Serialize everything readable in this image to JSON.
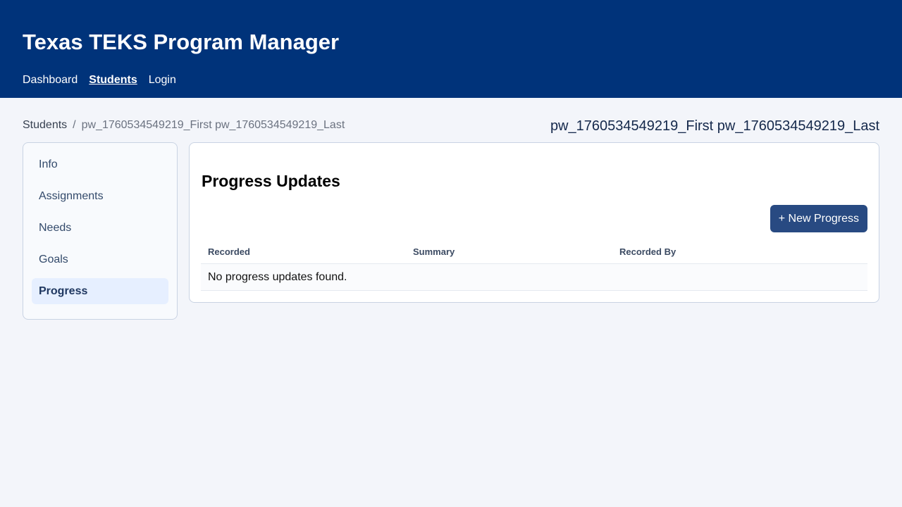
{
  "header": {
    "title": "Texas TEKS Program Manager",
    "nav": [
      {
        "label": "Dashboard"
      },
      {
        "label": "Students",
        "active": true
      },
      {
        "label": "Login"
      }
    ]
  },
  "breadcrumb": {
    "root": "Students",
    "separator": "/",
    "current": "pw_1760534549219_First pw_1760534549219_Last"
  },
  "student": {
    "name": "pw_1760534549219_First pw_1760534549219_Last"
  },
  "sidebar": {
    "items": [
      {
        "label": "Info"
      },
      {
        "label": "Assignments"
      },
      {
        "label": "Needs"
      },
      {
        "label": "Goals"
      },
      {
        "label": "Progress",
        "active": true
      }
    ]
  },
  "main": {
    "title": "Progress Updates",
    "new_button_label": "+ New Progress",
    "table": {
      "columns": [
        "Recorded",
        "Summary",
        "Recorded By"
      ],
      "empty_message": "No progress updates found."
    }
  },
  "colors": {
    "header_bg": "#00337a",
    "button_bg": "#284a82",
    "sidebar_active_bg": "#e6efff",
    "page_bg": "#f3f5fa"
  }
}
